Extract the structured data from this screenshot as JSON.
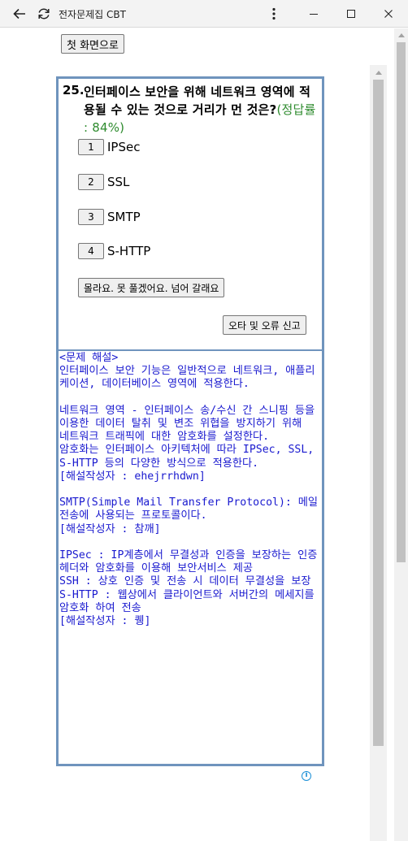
{
  "window": {
    "title": "전자문제집 CBT"
  },
  "page": {
    "home_label": "첫 화면으로"
  },
  "question": {
    "number": "25.",
    "text": "인터페이스 보안을 위해 네트워크 영역에 적용될 수 있는 것으로 거리가 먼 것은?",
    "rate": "(정답률 : 84%)",
    "choices": [
      {
        "num": "1",
        "text": "IPSec"
      },
      {
        "num": "2",
        "text": "SSL"
      },
      {
        "num": "3",
        "text": "SMTP"
      },
      {
        "num": "4",
        "text": "S-HTTP"
      }
    ],
    "skip_label": "몰라요. 못 풀겠어요. 넘어 갈래요",
    "report_label": "오타 및 오류 신고"
  },
  "explanation": {
    "lines": [
      "<문제 해설>",
      "인터페이스 보안 기능은 일반적으로 네트워크, 애플리케이션, 데이터베이스 영역에 적용한다.",
      "",
      "네트워크 영역 - 인터페이스 송/수신 간 스니핑 등을 이용한 데이터 탈취 및 변조 위협을 방지하기 위해",
      "네트워크 트래픽에 대한 암호화를 설정한다.",
      "암호화는 인터페이스 아키텍처에 따라 IPSec, SSL, S-HTTP 등의 다양한 방식으로 적용한다.",
      "[해설작성자 : ehejrrhdwn]",
      "",
      "SMTP(Simple Mail Transfer Protocol): 메일 전송에 사용되는 프로토콜이다.",
      "[해설작성자 : 참깨]",
      "",
      "IPSec : IP계층에서 무결성과 인증을 보장하는 인증헤더와 암호화를 이용해 보안서비스 제공",
      "SSH : 상호 인증 및 전송 시 데이터 무결성을 보장",
      "S-HTTP : 웹상에서 클라이언트와 서버간의 메세지를 암호화 하여 전송",
      "[해설작성자 : 퀭]"
    ]
  },
  "ad": {
    "info_glyph": "i"
  },
  "colors": {
    "box_border": "#6f94bd",
    "explain_text": "#1a1acf",
    "rate_text": "#2e8b2e"
  },
  "icons": [
    "back-arrow-icon",
    "reload-icon",
    "more-vert-icon",
    "minimize-icon",
    "maximize-icon",
    "close-icon",
    "info-icon"
  ]
}
